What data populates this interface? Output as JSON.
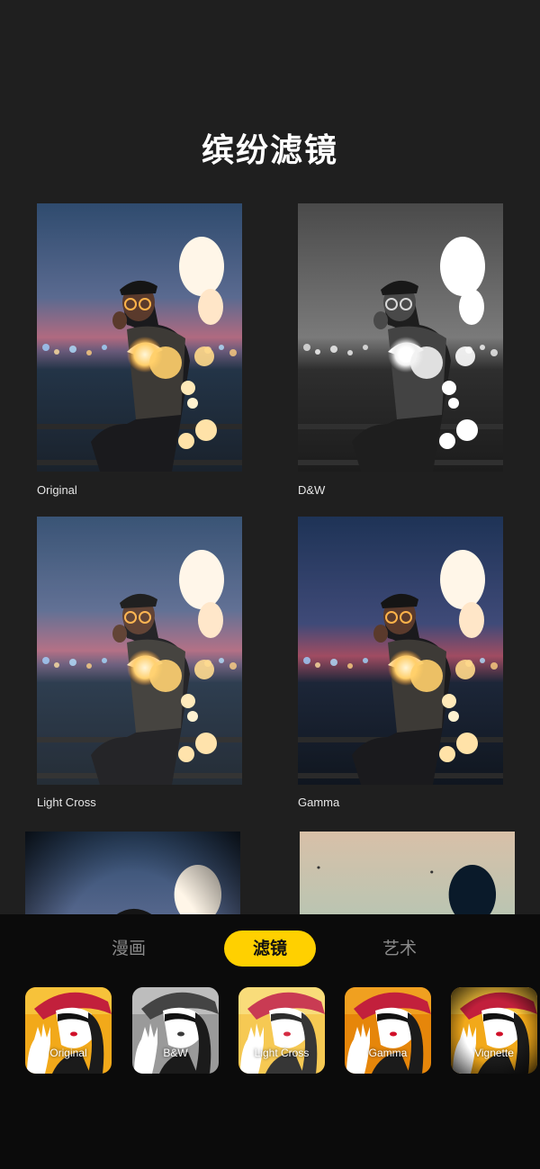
{
  "page": {
    "title": "缤纷滤镜"
  },
  "preview_grid": [
    {
      "caption": "Original"
    },
    {
      "caption": "D&W"
    },
    {
      "caption": "Light Cross"
    },
    {
      "caption": "Gamma"
    }
  ],
  "tabs": [
    {
      "label": "漫画",
      "active": false
    },
    {
      "label": "滤镜",
      "active": true
    },
    {
      "label": "艺术",
      "active": false
    }
  ],
  "filters": [
    {
      "label": "Original"
    },
    {
      "label": "B&W"
    },
    {
      "label": "Light Cross"
    },
    {
      "label": "Gamma"
    },
    {
      "label": "Vignette"
    }
  ],
  "colors": {
    "background": "#1f1f1f",
    "panel": "#0b0b0b",
    "accent": "#ffd000"
  }
}
